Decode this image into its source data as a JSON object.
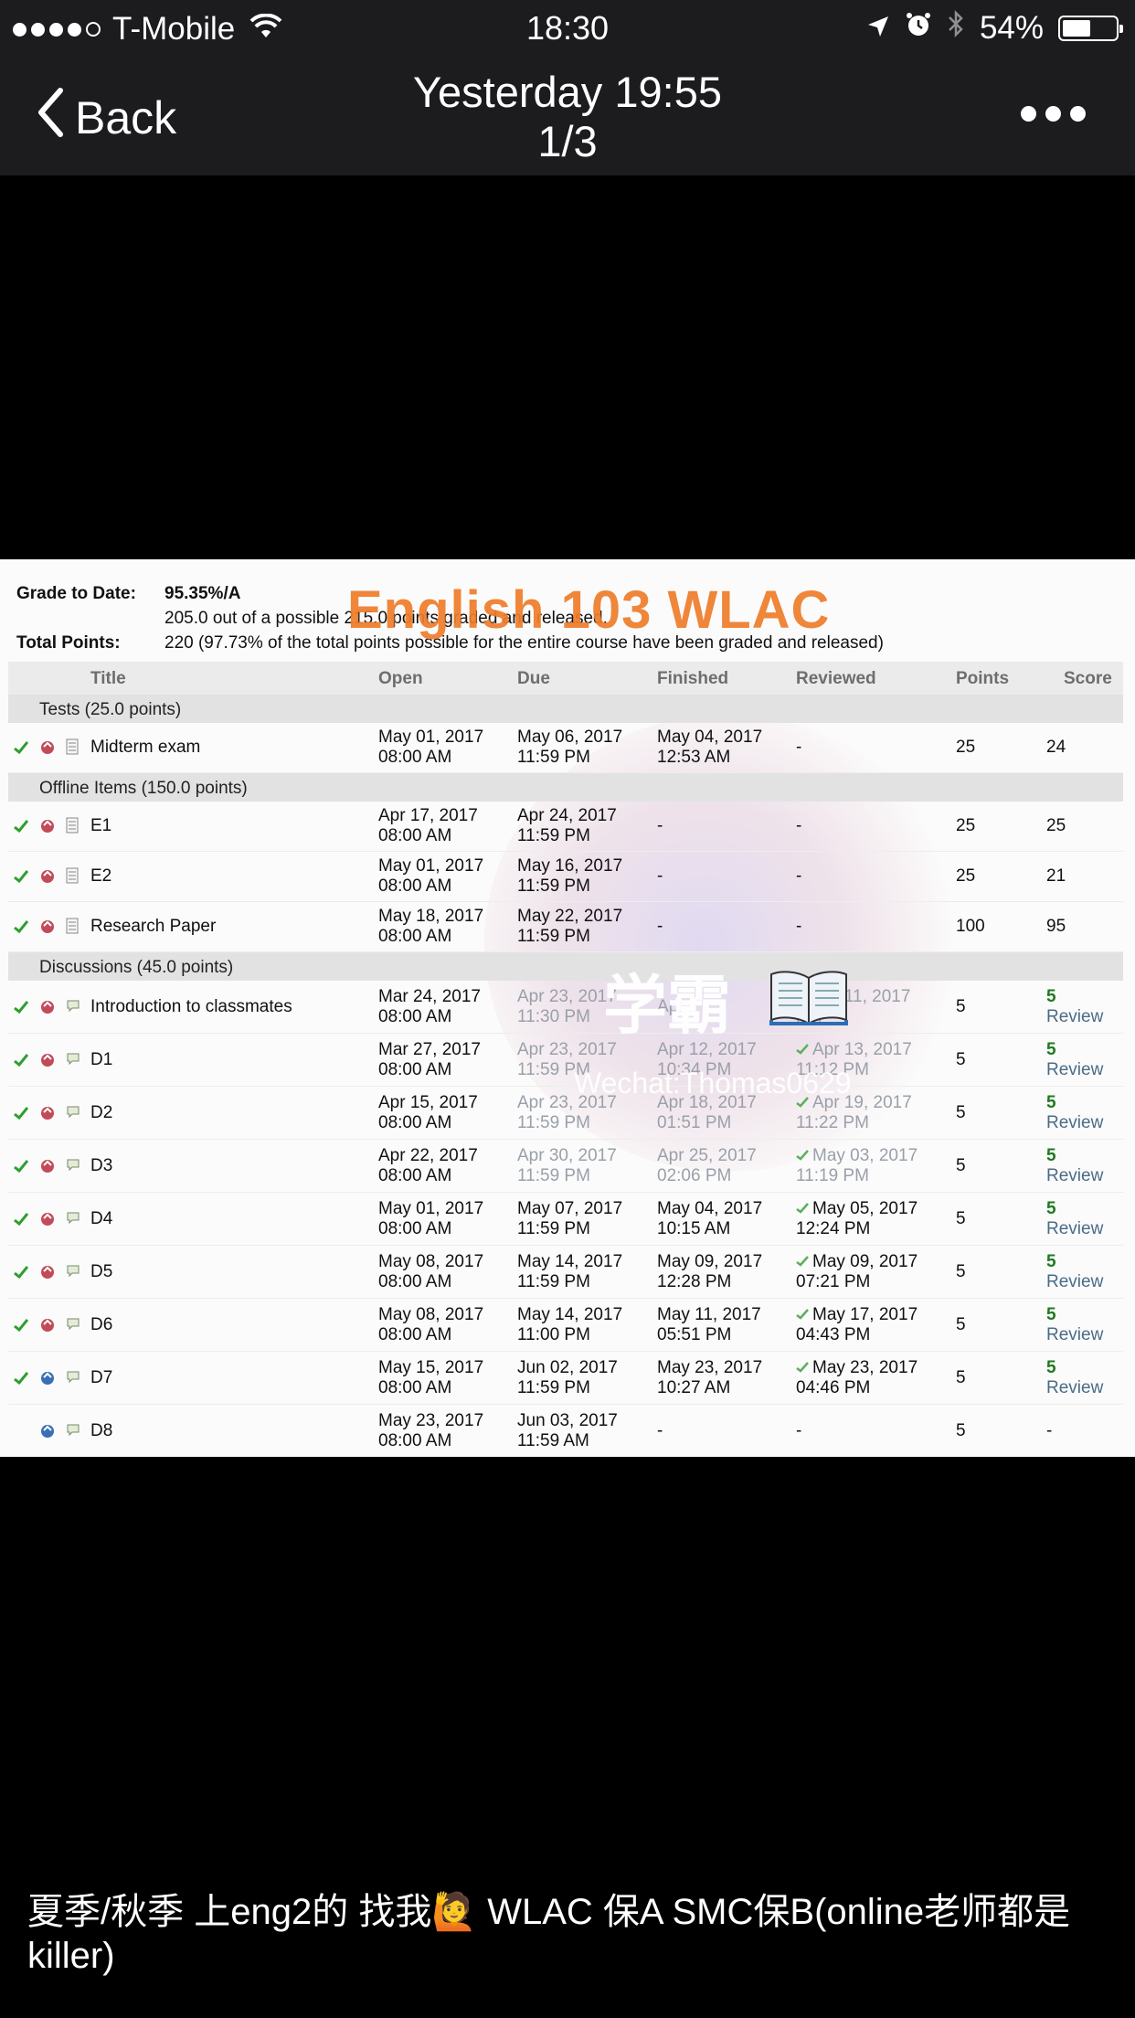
{
  "status_bar": {
    "carrier": "T-Mobile",
    "time": "18:30",
    "battery": "54%",
    "battery_level": 0.54,
    "signal_bars": 4
  },
  "nav": {
    "back_label": "Back",
    "title_line1": "Yesterday 19:55",
    "title_line2": "1/3"
  },
  "photo": {
    "grade_to_date_label": "Grade to Date:",
    "grade_to_date_value": "95.35%/A",
    "grade_detail": "205.0 out of a possible 215.0 points graded and released.",
    "total_points_label": "Total Points:",
    "total_points_value": "220 (97.73% of the total points possible for the entire course have been graded and released)",
    "watermark_title": "English 103 WLAC",
    "watermark_main": "学霸",
    "watermark_sub": "Wechat:Thomas0629",
    "table": {
      "headers": {
        "title": "Title",
        "open": "Open",
        "due": "Due",
        "finished": "Finished",
        "reviewed": "Reviewed",
        "points": "Points",
        "score": "Score"
      },
      "sections": [
        {
          "label": "Tests (25.0 points)",
          "rows": [
            {
              "title": "Midterm exam",
              "open1": "May 01, 2017",
              "open2": "08:00 AM",
              "due1": "May 06, 2017",
              "due2": "11:59 PM",
              "fin1": "May 04, 2017",
              "fin2": "12:53 AM",
              "rev1": "-",
              "rev2": "",
              "points": "25",
              "score": "24",
              "review": ""
            }
          ]
        },
        {
          "label": "Offline Items (150.0 points)",
          "rows": [
            {
              "title": "E1",
              "open1": "Apr 17, 2017",
              "open2": "08:00 AM",
              "due1": "Apr 24, 2017",
              "due2": "11:59 PM",
              "fin1": "-",
              "fin2": "",
              "rev1": "-",
              "rev2": "",
              "points": "25",
              "score": "25",
              "review": ""
            },
            {
              "title": "E2",
              "open1": "May 01, 2017",
              "open2": "08:00 AM",
              "due1": "May 16, 2017",
              "due2": "11:59 PM",
              "fin1": "-",
              "fin2": "",
              "rev1": "-",
              "rev2": "",
              "points": "25",
              "score": "21",
              "review": ""
            },
            {
              "title": "Research Paper",
              "open1": "May 18, 2017",
              "open2": "08:00 AM",
              "due1": "May 22, 2017",
              "due2": "11:59 PM",
              "fin1": "-",
              "fin2": "",
              "rev1": "-",
              "rev2": "",
              "points": "100",
              "score": "95",
              "review": ""
            }
          ]
        },
        {
          "label": "Discussions (45.0 points)",
          "rows": [
            {
              "title": "Introduction to classmates",
              "open1": "Mar 24, 2017",
              "open2": "08:00 AM",
              "due1": "Apr 23, 2017",
              "due2": "11:30 PM",
              "fin1": "Apr",
              "fin2": "",
              "rev1": "Apr 11, 2017",
              "rev2": "PM",
              "points": "5",
              "score": "5",
              "review": "Review"
            },
            {
              "title": "D1",
              "open1": "Mar 27, 2017",
              "open2": "08:00 AM",
              "due1": "Apr 23, 2017",
              "due2": "11:59 PM",
              "fin1": "Apr 12, 2017",
              "fin2": "10:34 PM",
              "rev1": "Apr 13, 2017",
              "rev2": "11:12 PM",
              "points": "5",
              "score": "5",
              "review": "Review"
            },
            {
              "title": "D2",
              "open1": "Apr 15, 2017",
              "open2": "08:00 AM",
              "due1": "Apr 23, 2017",
              "due2": "11:59 PM",
              "fin1": "Apr 18, 2017",
              "fin2": "01:51 PM",
              "rev1": "Apr 19, 2017",
              "rev2": "11:22 PM",
              "points": "5",
              "score": "5",
              "review": "Review"
            },
            {
              "title": "D3",
              "open1": "Apr 22, 2017",
              "open2": "08:00 AM",
              "due1": "Apr 30, 2017",
              "due2": "11:59 PM",
              "fin1": "Apr 25, 2017",
              "fin2": "02:06 PM",
              "rev1": "May 03, 2017",
              "rev2": "11:19 PM",
              "points": "5",
              "score": "5",
              "review": "Review"
            },
            {
              "title": "D4",
              "open1": "May 01, 2017",
              "open2": "08:00 AM",
              "due1": "May 07, 2017",
              "due2": "11:59 PM",
              "fin1": "May 04, 2017",
              "fin2": "10:15 AM",
              "rev1": "May 05, 2017",
              "rev2": "12:24 PM",
              "points": "5",
              "score": "5",
              "review": "Review"
            },
            {
              "title": "D5",
              "open1": "May 08, 2017",
              "open2": "08:00 AM",
              "due1": "May 14, 2017",
              "due2": "11:59 PM",
              "fin1": "May 09, 2017",
              "fin2": "12:28 PM",
              "rev1": "May 09, 2017",
              "rev2": "07:21 PM",
              "points": "5",
              "score": "5",
              "review": "Review"
            },
            {
              "title": "D6",
              "open1": "May 08, 2017",
              "open2": "08:00 AM",
              "due1": "May 14, 2017",
              "due2": "11:00 PM",
              "fin1": "May 11, 2017",
              "fin2": "05:51 PM",
              "rev1": "May 17, 2017",
              "rev2": "04:43 PM",
              "points": "5",
              "score": "5",
              "review": "Review"
            },
            {
              "title": "D7",
              "open1": "May 15, 2017",
              "open2": "08:00 AM",
              "due1": "Jun 02, 2017",
              "due2": "11:59 PM",
              "fin1": "May 23, 2017",
              "fin2": "10:27 AM",
              "rev1": "May 23, 2017",
              "rev2": "04:46 PM",
              "points": "5",
              "score": "5",
              "review": "Review"
            },
            {
              "title": "D8",
              "open1": "May 23, 2017",
              "open2": "08:00 AM",
              "due1": "Jun 03, 2017",
              "due2": "11:59 AM",
              "fin1": "-",
              "fin2": "",
              "rev1": "-",
              "rev2": "",
              "points": "5",
              "score": "-",
              "review": ""
            }
          ]
        }
      ]
    }
  },
  "caption": "夏季/秋季 上eng2的 找我🙋 WLAC 保A SMC保B(online老师都是killer)",
  "colors": {
    "bar_bg": "#1c1c1e",
    "watermark_orange": "#ef7d2a",
    "check_green": "#2e9e2e",
    "score_green": "#1f7a1f",
    "review_link": "#4a6b86"
  }
}
